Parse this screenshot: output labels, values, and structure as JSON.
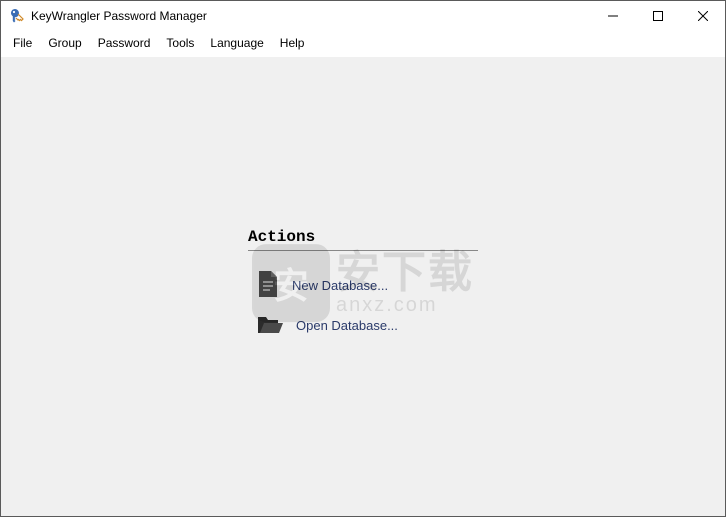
{
  "window": {
    "title": "KeyWrangler Password Manager"
  },
  "menu": {
    "items": [
      "File",
      "Group",
      "Password",
      "Tools",
      "Language",
      "Help"
    ]
  },
  "actions": {
    "heading": "Actions",
    "new_db_label": "New Database...",
    "open_db_label": "Open Database..."
  },
  "watermark": {
    "badge": "安",
    "line1": "安下载",
    "line2": "anxz.com"
  }
}
